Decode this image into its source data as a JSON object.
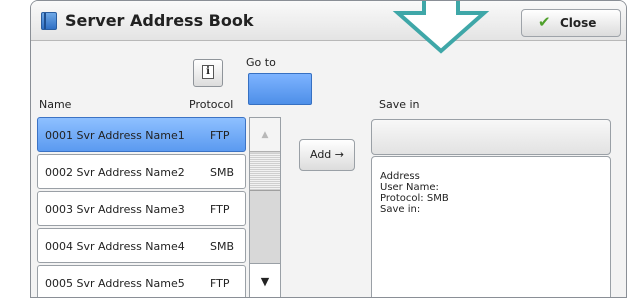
{
  "window": {
    "title": "Server Address Book"
  },
  "toolbar": {
    "close_label": "Close",
    "close_icon": "checkmark-icon",
    "info_glyph": "i"
  },
  "goto": {
    "label": "Go to",
    "value": ""
  },
  "columns": {
    "name": "Name",
    "protocol": "Protocol"
  },
  "entries": [
    {
      "name": "0001  Svr Address Name1",
      "protocol": "FTP",
      "selected": true
    },
    {
      "name": "0002  Svr Address Name2",
      "protocol": "SMB",
      "selected": false
    },
    {
      "name": "0003  Svr Address Name3",
      "protocol": "FTP",
      "selected": false
    },
    {
      "name": "0004  Svr Address Name4",
      "protocol": "SMB",
      "selected": false
    },
    {
      "name": "0005  Svr Address Name5",
      "protocol": "FTP",
      "selected": false
    }
  ],
  "add_button": {
    "label": "Add →"
  },
  "save_in": {
    "label": "Save in",
    "value": "",
    "details": [
      "Address",
      "User Name:",
      "Protocol: SMB",
      "Save in:"
    ]
  },
  "scrollbar": {
    "up_glyph": "▲",
    "down_glyph": "▼"
  },
  "colors": {
    "selection": "#5b9af0",
    "highlight_arrow": "#3fa7a8",
    "accent_check": "#4fa02b"
  }
}
